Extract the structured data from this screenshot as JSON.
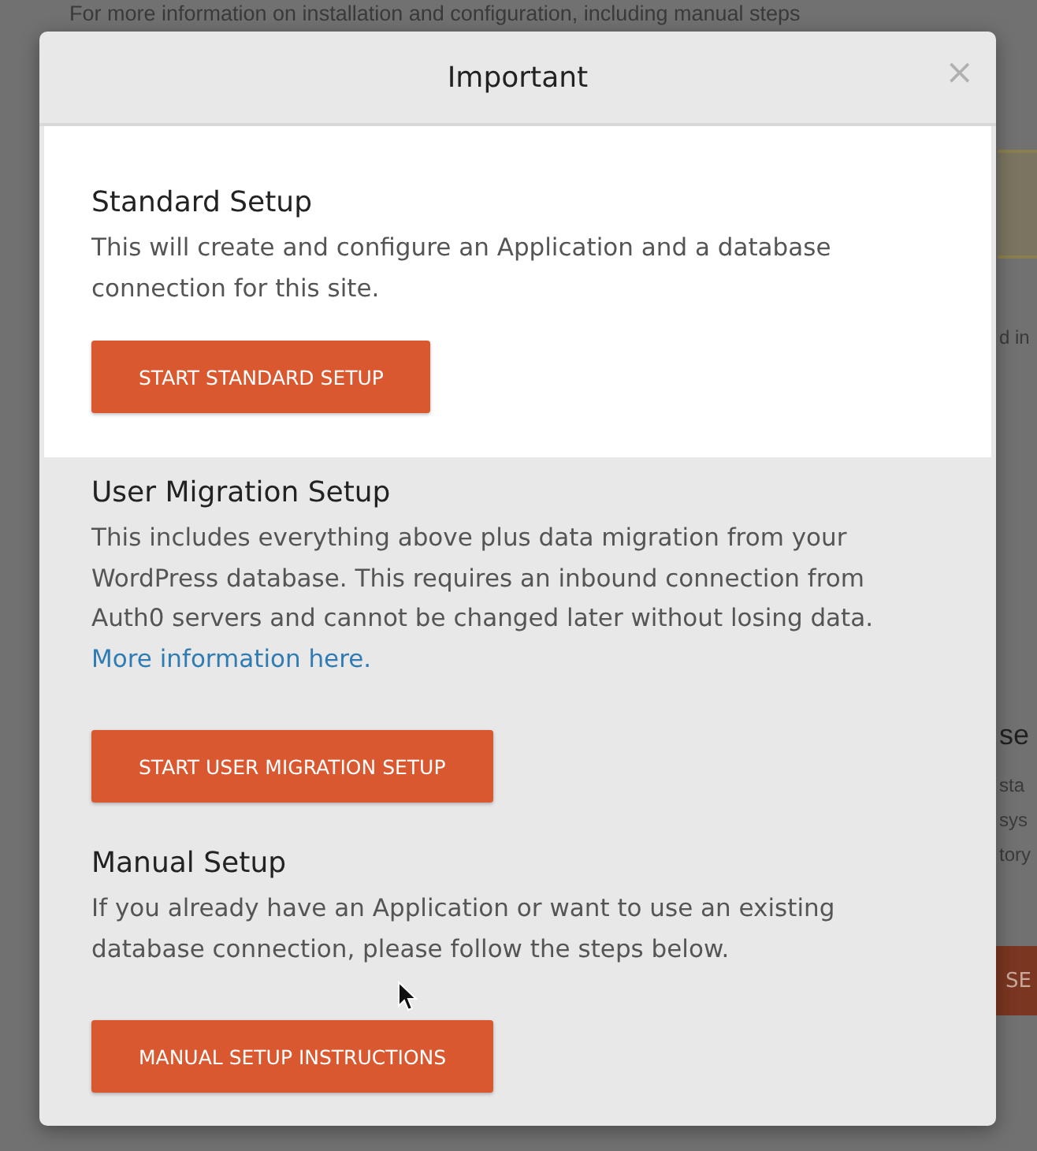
{
  "background": {
    "intro": "For more information on installation and configuration, including manual steps",
    "fragments": [
      {
        "text": "d in",
        "kind": "line"
      },
      {
        "text": "se",
        "kind": "heading"
      },
      {
        "text": "sta",
        "kind": "line"
      },
      {
        "text": "sys",
        "kind": "line"
      },
      {
        "text": "tory",
        "kind": "line"
      }
    ],
    "button": "SE"
  },
  "modal": {
    "title": "Important",
    "close": "×",
    "sections": [
      {
        "heading": "Standard Setup",
        "text": "This will create and configure an Application and a database connection for this site.",
        "button": "START STANDARD SETUP",
        "selected": true
      },
      {
        "heading": "User Migration Setup",
        "text": "This includes everything above plus data migration from your WordPress database. This requires an inbound connection from Auth0 servers and cannot be changed later without losing data.",
        "link": "More information here.",
        "button": "START USER MIGRATION SETUP",
        "selected": false
      },
      {
        "heading": "Manual Setup",
        "text": "If you already have an Application or want to use an existing database connection, please follow the steps below.",
        "button": "MANUAL SETUP INSTRUCTIONS",
        "selected": false
      }
    ]
  }
}
